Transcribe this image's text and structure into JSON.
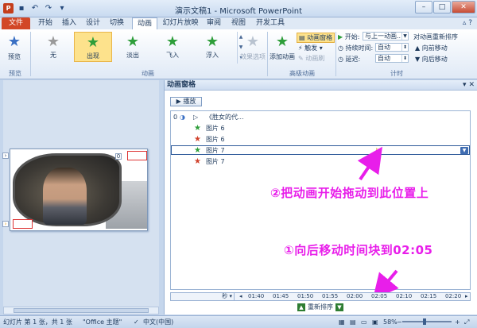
{
  "window": {
    "title": "演示文稿1 - Microsoft PowerPoint",
    "app_icon_letter": "P"
  },
  "ribbon_tabs": [
    "文件",
    "开始",
    "插入",
    "设计",
    "切换",
    "动画",
    "幻灯片放映",
    "审阅",
    "视图",
    "开发工具"
  ],
  "ribbon": {
    "preview_label": "预览",
    "preview_group": "预览",
    "animation_group": "动画",
    "gallery": [
      {
        "label": "无",
        "icon": "star-gray"
      },
      {
        "label": "出现",
        "icon": "star-green"
      },
      {
        "label": "淡出",
        "icon": "star-green"
      },
      {
        "label": "飞入",
        "icon": "star-green"
      },
      {
        "label": "浮入",
        "icon": "star-green"
      }
    ],
    "effect_options": "效果选项",
    "add_animation": "添加动画",
    "anim_pane_btn": "动画窗格",
    "trigger_btn": "触发",
    "anim_painter_btn": "动画刷",
    "advanced_group": "高级动画",
    "start_label": "开始:",
    "start_value": "与上一动画...",
    "duration_label": "持续时间:",
    "duration_value": "自动",
    "delay_label": "延迟:",
    "delay_value": "自动",
    "timing_group": "计时",
    "reorder_title": "对动画重新排序",
    "move_earlier": "向前移动",
    "move_later": "向后移动"
  },
  "pane": {
    "title": "动画窗格",
    "play_label": "播放",
    "items": [
      {
        "index": "0",
        "label": "《胜女的代...",
        "icon": "play-trigger",
        "color": "#333333",
        "selected": false
      },
      {
        "index": "",
        "label": "图片 6",
        "icon": "star",
        "color": "#2e9e3a",
        "selected": false
      },
      {
        "index": "",
        "label": "图片 6",
        "icon": "star",
        "color": "#d0402a",
        "selected": false
      },
      {
        "index": "",
        "label": "图片 7",
        "icon": "star",
        "color": "#2e9e3a",
        "selected": true
      },
      {
        "index": "",
        "label": "图片 7",
        "icon": "star",
        "color": "#d0402a",
        "selected": false
      }
    ],
    "annotation_drag": "②把动画开始拖动到此位置上",
    "annotation_move": "①向后移动时间块到02:05",
    "timeline_unit": "秒",
    "timeline_ticks": [
      "01:40",
      "01:45",
      "01:50",
      "01:55",
      "02:00",
      "02:05",
      "02:10",
      "02:15",
      "02:20"
    ],
    "reorder_label": "重新排序"
  },
  "status": {
    "slide_info": "幻灯片 第 1 张，共 1 张",
    "theme": "\"Office 主题\"",
    "language": "中文(中国)",
    "zoom": "58%"
  },
  "colors": {
    "annotation": "#e81eea",
    "file_tab": "#d24726",
    "selection_border": "#2f5b9a"
  }
}
